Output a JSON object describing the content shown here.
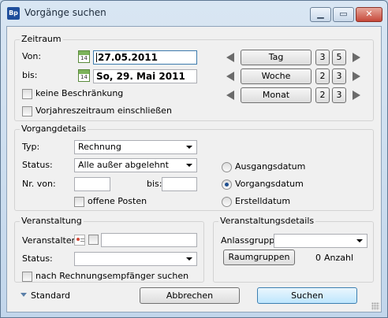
{
  "window": {
    "title": "Vorgänge suchen",
    "app_icon_text": "Bp",
    "controls": {
      "minimize": "▁",
      "maximize": "▭",
      "close": "✕"
    }
  },
  "zeitraum": {
    "legend": "Zeitraum",
    "von_label": "Von:",
    "von_value": "27.05.2011",
    "bis_label": "bis:",
    "bis_value": "So, 29. Mai 2011",
    "calendar_day": "14",
    "keine_beschraenkung": "keine Beschränkung",
    "vorjahreszeitraum": "Vorjahreszeitraum einschließen",
    "periods": [
      {
        "label": "Tag",
        "a": "3",
        "b": "5"
      },
      {
        "label": "Woche",
        "a": "2",
        "b": "3"
      },
      {
        "label": "Monat",
        "a": "2",
        "b": "3"
      }
    ]
  },
  "vorgangdetails": {
    "legend": "Vorgangdetails",
    "typ_label": "Typ:",
    "typ_value": "Rechnung",
    "status_label": "Status:",
    "status_value": "Alle außer abgelehnt",
    "nrvon_label": "Nr. von:",
    "nrbis_label": "bis:",
    "offene_posten": "offene Posten",
    "date_options": [
      "Ausgangsdatum",
      "Vorgangsdatum",
      "Erstelldatum"
    ],
    "selected_date_option": "Vorgangsdatum"
  },
  "veranstaltung": {
    "legend": "Veranstaltung",
    "veranstalter_label": "Veranstalter:",
    "status_label": "Status:",
    "rechnungsempfaenger": "nach Rechnungsempfänger suchen"
  },
  "veranstaltungsdetails": {
    "legend": "Veranstaltungsdetails",
    "anlassgruppe_label": "Anlassgruppe",
    "raumgruppen_button": "Raumgruppen",
    "count": "0",
    "count_label": "Anzahl"
  },
  "footer": {
    "standard": "Standard",
    "abbrechen": "Abbrechen",
    "suchen": "Suchen"
  }
}
